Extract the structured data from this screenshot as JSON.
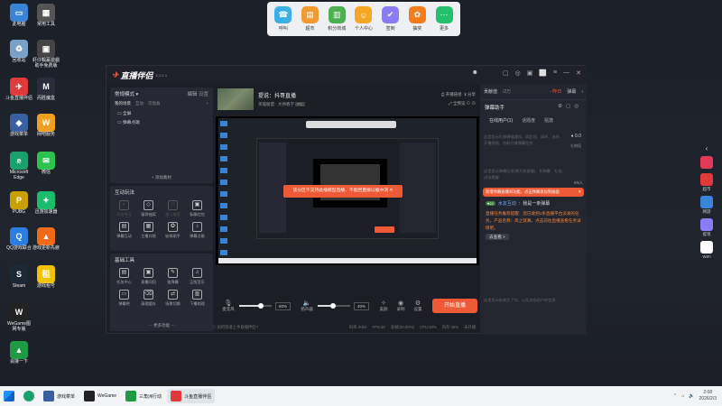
{
  "desktop_icons": [
    {
      "label": "此电脑",
      "color": "#3a84d8",
      "glyph": "▭"
    },
    {
      "label": "常用工具",
      "color": "#555",
      "glyph": "▦"
    },
    {
      "label": "回收站",
      "color": "#7aa0c8",
      "glyph": "♻"
    },
    {
      "label": "虾仔輸贏遊戲助手免费版",
      "color": "#444",
      "glyph": "▣"
    },
    {
      "label": "斗鱼直播伴侣",
      "color": "#e03a3a",
      "glyph": "✈"
    },
    {
      "label": "而胜魔盒",
      "color": "#2b2b3a",
      "glyph": "M"
    },
    {
      "label": "游戏菜单",
      "color": "#3a5fa0",
      "glyph": "◆"
    },
    {
      "label": "网吧服务",
      "color": "#f0a020",
      "glyph": "W"
    },
    {
      "label": "Microsoft Edge",
      "color": "#1aa06a",
      "glyph": "e"
    },
    {
      "label": "微信",
      "color": "#2dc24d",
      "glyph": "✉"
    },
    {
      "label": "PUBG",
      "color": "#c9a000",
      "glyph": "P"
    },
    {
      "label": "迅游加速器",
      "color": "#1bbc6b",
      "glyph": "✦"
    },
    {
      "label": "QQ游戏联合",
      "color": "#2a7de1",
      "glyph": "Q"
    },
    {
      "label": "游戏更新先疲",
      "color": "#f06a1a",
      "glyph": "▲"
    },
    {
      "label": "Steam",
      "color": "#1b2838",
      "glyph": "S"
    },
    {
      "label": "游戏租号",
      "color": "#f2c200",
      "glyph": "租"
    },
    {
      "label": "WeGame图网专版",
      "color": "#222",
      "glyph": "W"
    },
    {
      "label": "会接一下",
      "color": "#1f9a44",
      "glyph": "▲"
    }
  ],
  "top_dock": [
    {
      "label": "呼叫",
      "color": "#3ab0e6",
      "glyph": "☎"
    },
    {
      "label": "超市",
      "color": "#f29a2e",
      "glyph": "▤"
    },
    {
      "label": "积分商城",
      "color": "#4caf50",
      "glyph": "▥"
    },
    {
      "label": "个人中心",
      "color": "#f5a623",
      "glyph": "☺"
    },
    {
      "label": "签到",
      "color": "#8a7cf5",
      "glyph": "✔"
    },
    {
      "label": "抽奖",
      "color": "#f57c1a",
      "glyph": "✿"
    },
    {
      "label": "更多",
      "color": "#25c06e",
      "glyph": "⋯"
    }
  ],
  "app": {
    "title": "直播伴侣",
    "version": "6.3.5.4",
    "scene_mode": "常规模式",
    "scene_tabs": [
      "编辑",
      "设置"
    ],
    "scene_subtabs": [
      "我的场景",
      "互动",
      "可能备"
    ],
    "sources": [
      "全屏",
      "弹幕点歌"
    ],
    "add_material": "+ 添加素材",
    "interact_title": "互动玩法",
    "interact_row1": [
      "开启关注",
      "福袋抽奖",
      "邀人推荐",
      "私聊红包"
    ],
    "interact_row2": [
      "弹幕互动",
      "主播口袋",
      "轮椅助手",
      "弹幕点歌"
    ],
    "basic_title": "基础工具",
    "basic_row1": [
      "任务中心",
      "直播间回",
      "鉴弹幕",
      "正版音乐"
    ],
    "basic_row2": [
      "弹幕吧",
      "清理缓存",
      "场景切换",
      "下播助理"
    ],
    "more_features": "更多功能",
    "room_title": "提说：抖哥直播",
    "room_sub": "英雄联盟 · 大神教学",
    "room_badge": "PC",
    "open_live_link": "开播链接",
    "share": "分享",
    "fullscreen": "全预览",
    "alert": "该分区不支持此播模型直播，不能回直接以推中消",
    "mic_label": "麦克风",
    "mic_vol": "60%",
    "speaker_label": "扬声器",
    "speaker_vol": "40%",
    "btn_beauty": "美颜",
    "btn_record": "录制",
    "btn_settings": "设置",
    "start_live": "开始直播",
    "status_hint": "如何快速上手直播伴侣?",
    "status_stats": [
      "码率 /Kb/s",
      "FPS:20",
      "丢帧(00.00%)",
      "CPU:10%",
      "内存:45%",
      "未开播"
    ],
    "right_tabs": [
      "贡献值",
      "/2万",
      "昨日",
      "弹幕"
    ],
    "assistant_title": "弹幕助手",
    "assistant_tabs": [
      "在线用户(1)",
      "话题度",
      "贴筋"
    ],
    "assistant_hint": "这里显示礼物横幅通知，如此领、请求、选举开播视频，钻粉开播弹幕信息",
    "gift_value": "0.0",
    "gift_note": "礼物值",
    "barrage_hint": "这里显示弹幕信息(需开放直播)，如弹幕、礼物、进场提醒",
    "barrage_count": "0/5人",
    "red_notice": "新增弹幕直播间功能，点击弹幕添加到画面",
    "user_level": "22",
    "user_name": "水友互动",
    "user_msg": "我是一条弹幕",
    "system_msg": "直播任务推荐提醒：您已收到1条直播平台派发的任务，产品名称：风之就舞，点击前往直播查看任务详情吧。",
    "go_look": "去查看 >",
    "bottom_hint": "这里显示新关注了你，以及进场用户的信息"
  },
  "side_bar": [
    {
      "label": "",
      "color": "#e03a5a"
    },
    {
      "label": "超市",
      "color": "#e03a3a"
    },
    {
      "label": "网游",
      "color": "#3a84d8"
    },
    {
      "label": "提现",
      "color": "#8a7cf5"
    },
    {
      "label": "WiFi",
      "color": "#ffffff"
    }
  ],
  "taskbar": {
    "items": [
      "游戏菜单",
      "WeGame",
      "三角洲行动",
      "斗鱼直播伴侣"
    ],
    "time": "2:08",
    "date": "2026/2/3"
  }
}
